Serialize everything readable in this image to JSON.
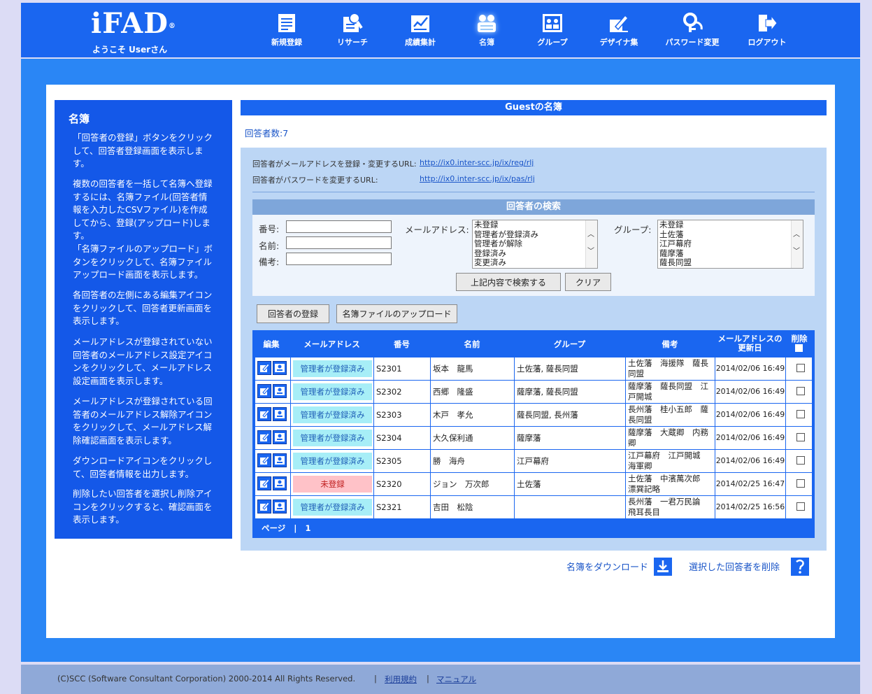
{
  "header": {
    "logo": "iFAD",
    "logo_mark": "®",
    "welcome": "ようこそ Userさん",
    "nav": [
      {
        "label": "新規登録",
        "icon": "document-icon"
      },
      {
        "label": "リサーチ",
        "icon": "research-icon"
      },
      {
        "label": "成績集計",
        "icon": "tally-icon"
      },
      {
        "label": "名簿",
        "icon": "roster-icon"
      },
      {
        "label": "グループ",
        "icon": "group-icon"
      },
      {
        "label": "デザイナ集",
        "icon": "designer-icon"
      },
      {
        "label": "パスワード変更",
        "icon": "password-icon"
      },
      {
        "label": "ログアウト",
        "icon": "logout-icon"
      }
    ]
  },
  "sidebar": {
    "title": "名簿",
    "paragraphs": [
      "「回答者の登録」ボタンをクリックして、回答者登録画面を表示します。",
      "複数の回答者を一括して名簿へ登録するには、名簿ファイル(回答者情報を入力したCSVファイル)を作成してから、登録(アップロード)します。",
      "「名簿ファイルのアップロード」ボタンをクリックして、名簿ファイルアップロード画面を表示します。",
      "各回答者の左側にある編集アイコンをクリックして、回答者更新画面を表示します。",
      "メールアドレスが登録されていない回答者のメールアドレス設定アイコンをクリックして、メールアドレス設定画面を表示します。",
      "メールアドレスが登録されている回答者のメールアドレス解除アイコンをクリックして、メールアドレス解除確認画面を表示します。",
      "ダウンロードアイコンをクリックして、回答者情報を出力します。",
      "削除したい回答者を選択し削除アイコンをクリックすると、確認画面を表示します。"
    ]
  },
  "main": {
    "title": "Guestの名簿",
    "respondent_count": "回答者数:7",
    "urls": [
      {
        "label": "回答者がメールアドレスを登録・変更するURL:",
        "url": "http://ix0.inter-scc.jp/ix/reg/rlj"
      },
      {
        "label": "回答者がパスワードを変更するURL:",
        "url": "http://ix0.inter-scc.jp/ix/pas/rlj"
      }
    ],
    "search": {
      "title": "回答者の検索",
      "number_label": "番号:",
      "name_label": "名前:",
      "note_label": "備考:",
      "mail_label": "メールアドレス:",
      "mail_options": [
        "未登録",
        "管理者が登録済み",
        "管理者が解除",
        "登録済み",
        "変更済み"
      ],
      "group_label": "グループ:",
      "group_options": [
        "未登録",
        "土佐藩",
        "江戸幕府",
        "薩摩藩",
        "薩長同盟"
      ],
      "search_button": "上記内容で検索する",
      "clear_button": "クリア"
    },
    "register_button": "回答者の登録",
    "upload_button": "名簿ファイルのアップロード",
    "table": {
      "headers": {
        "edit": "編集",
        "mail": "メールアドレス",
        "number": "番号",
        "name": "名前",
        "group": "グループ",
        "note": "備考",
        "updated_1": "メールアドレスの",
        "updated_2": "更新日",
        "delete": "削除"
      },
      "rows": [
        {
          "status": "管理者が登録済み",
          "registered": true,
          "number": "S2301",
          "name": "坂本　龍馬",
          "group": "土佐藩, 薩長同盟",
          "note_1": "土佐藩　海援隊　薩長",
          "note_2": "同盟",
          "date": "2014/02/06 16:49"
        },
        {
          "status": "管理者が登録済み",
          "registered": true,
          "number": "S2302",
          "name": "西郷　隆盛",
          "group": "薩摩藩, 薩長同盟",
          "note_1": "薩摩藩　薩長同盟　江",
          "note_2": "戸開城",
          "date": "2014/02/06 16:49"
        },
        {
          "status": "管理者が登録済み",
          "registered": true,
          "number": "S2303",
          "name": "木戸　孝允",
          "group": "薩長同盟, 長州藩",
          "note_1": "長州藩　桂小五郎　薩",
          "note_2": "長同盟",
          "date": "2014/02/06 16:49"
        },
        {
          "status": "管理者が登録済み",
          "registered": true,
          "number": "S2304",
          "name": "大久保利通",
          "group": "薩摩藩",
          "note_1": "薩摩藩　大蔵卿　内務",
          "note_2": "卿",
          "date": "2014/02/06 16:49"
        },
        {
          "status": "管理者が登録済み",
          "registered": true,
          "number": "S2305",
          "name": "勝　海舟",
          "group": "江戸幕府",
          "note_1": "江戸幕府　江戸開城",
          "note_2": "海軍卿",
          "date": "2014/02/06 16:49"
        },
        {
          "status": "未登録",
          "registered": false,
          "number": "S2320",
          "name": "ジョン　万次郎",
          "group": "土佐藩",
          "note_1": "土佐藩　中濱萬次郎",
          "note_2": "漂巽記略",
          "date": "2014/02/25 16:47"
        },
        {
          "status": "管理者が登録済み",
          "registered": true,
          "number": "S2321",
          "name": "吉田　松陰",
          "group": "",
          "note_1": "長州藩　一君万民論",
          "note_2": "飛耳長目",
          "date": "2014/02/25 16:56"
        }
      ],
      "pager_label": "ページ",
      "pager_sep": "|",
      "pager_page": "1"
    },
    "download_link": "名簿をダウンロード",
    "delete_link": "選択した回答者を削除"
  },
  "footer": {
    "copyright": "(C)SCC (Software Consultant Corporation) 2000-2014 All Rights Reserved.",
    "sep": "|",
    "terms": "利用規約",
    "manual": "マニュアル"
  },
  "colors": {
    "header_blue": "#1a66f0",
    "band_blue": "#2a86f5",
    "registered_cell": "#a7eef7",
    "unregistered_cell": "#ffc2c8"
  }
}
